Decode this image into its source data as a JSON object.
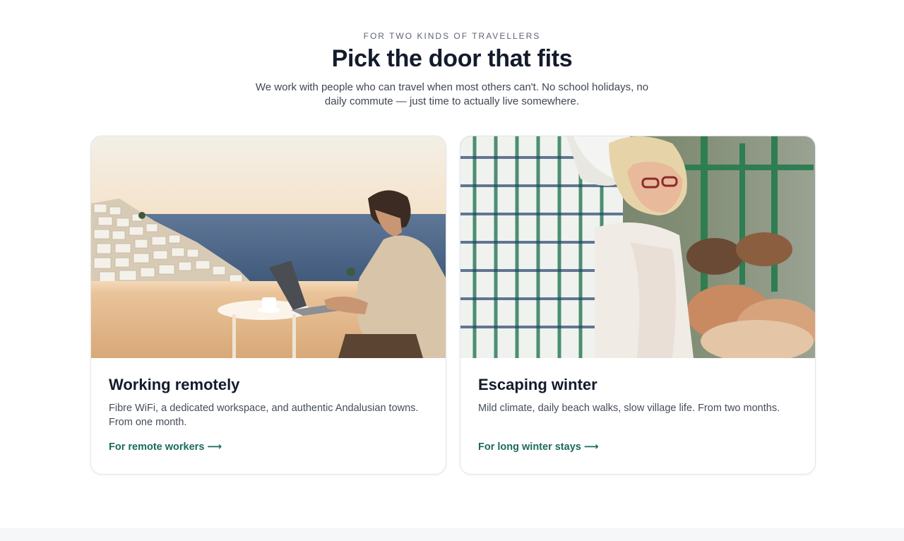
{
  "section": {
    "eyebrow": "FOR TWO KINDS OF TRAVELLERS",
    "title": "Pick the door that fits",
    "intro": "We work with people who can travel when most others can't. No school holidays, no daily commute — just time to actually live somewhere."
  },
  "cards": [
    {
      "image_alt": "Young man working on a laptop on a sunny terrace overlooking a white Andalusian village and the sea",
      "title": "Working remotely",
      "description": "Fibre WiFi, a dedicated workspace, and authentic Andalusian towns. From one month.",
      "link_label": "For remote workers",
      "link_arrow": "⟶"
    },
    {
      "image_alt": "Smiling older couple browsing a local market",
      "title": "Escaping winter",
      "description": "Mild climate, daily beach walks, slow village life. From two months.",
      "link_label": "For long winter stays",
      "link_arrow": "⟶"
    }
  ],
  "colors": {
    "heading": "#141b2b",
    "body_text": "#454c59",
    "link": "#1b6b5d",
    "card_border": "#e3e5e8",
    "footer_band": "#f6f7f8"
  }
}
